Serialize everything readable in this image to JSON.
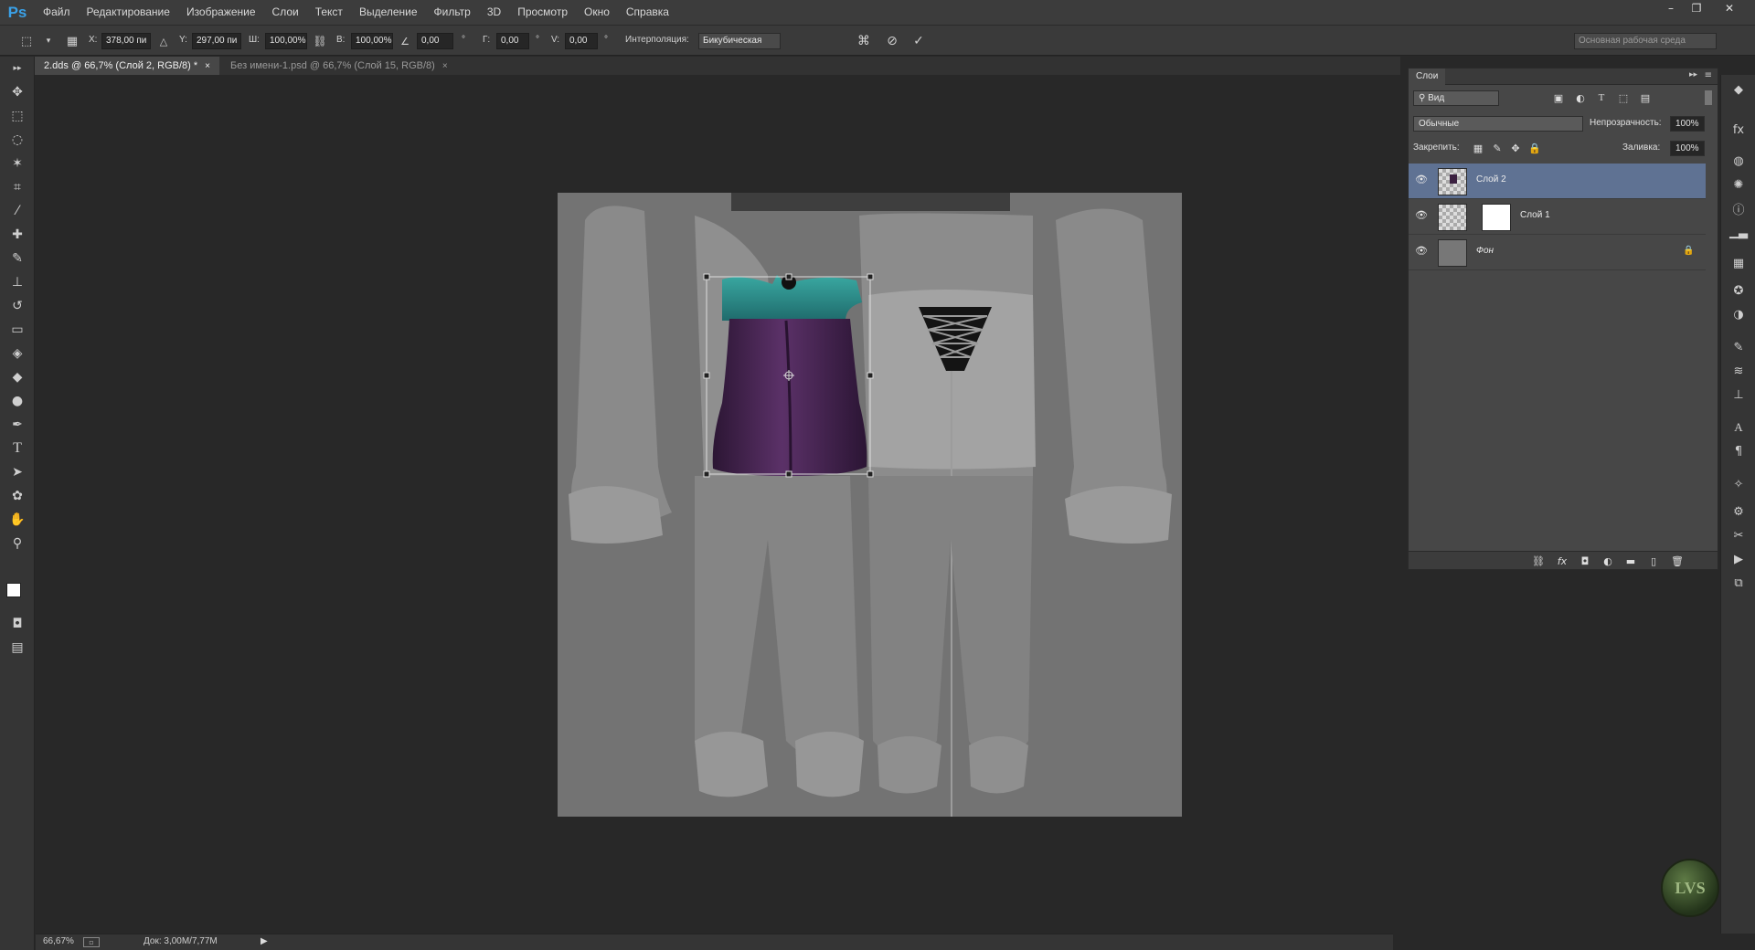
{
  "app": {
    "logo": "Ps"
  },
  "menu": [
    "Файл",
    "Редактирование",
    "Изображение",
    "Слои",
    "Текст",
    "Выделение",
    "Фильтр",
    "3D",
    "Просмотр",
    "Окно",
    "Справка"
  ],
  "window_controls": {
    "minimize": "–",
    "restore": "❐",
    "close": "✕"
  },
  "options": {
    "x_label": "X:",
    "x_value": "378,00 пи",
    "y_label": "Y:",
    "y_value": "297,00 пи",
    "w_label": "Ш:",
    "w_value": "100,00%",
    "h_label": "В:",
    "h_value": "100,00%",
    "angle_value": "0,00",
    "angle_unit": "°",
    "hskew_label": "Г:",
    "hskew_value": "0,00",
    "hskew_unit": "°",
    "vskew_label": "V:",
    "vskew_value": "0,00",
    "vskew_unit": "°",
    "interp_label": "Интерполяция:",
    "interp_value": "Бикубическая",
    "workspace": "Основная рабочая среда"
  },
  "tabs": [
    {
      "label": "2.dds @ 66,7% (Слой 2, RGB/8) *",
      "close": "×"
    },
    {
      "label": "Без имени-1.psd @ 66,7% (Слой 15, RGB/8)",
      "close": "×"
    }
  ],
  "layers_panel": {
    "tab": "Слои",
    "filter": "Вид",
    "blend_mode": "Обычные",
    "opacity_label": "Непрозрачность:",
    "opacity_value": "100%",
    "lock_label": "Закрепить:",
    "fill_label": "Заливка:",
    "fill_value": "100%",
    "layers": [
      {
        "name": "Слой 2",
        "selected": true
      },
      {
        "name": "Слой 1",
        "selected": false
      },
      {
        "name": "Фон",
        "selected": false
      }
    ]
  },
  "status": {
    "zoom": "66,67%",
    "doc": "Док: 3,00M/7,77M"
  },
  "watermark": "LVS",
  "colors": {
    "accent_selected_layer": "#5f7293",
    "dress_top": "#2f8f8a",
    "dress_body": "#4a2756"
  }
}
